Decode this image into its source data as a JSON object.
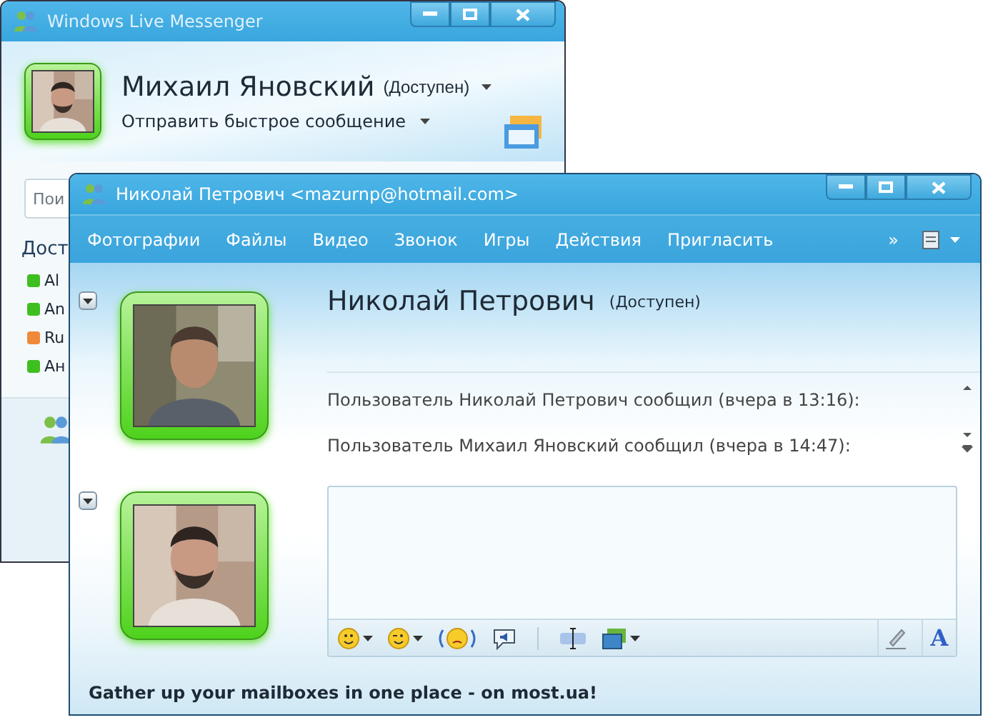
{
  "back_window": {
    "title": "Windows Live Messenger",
    "user_name": "Михаил Яновский",
    "user_status": "(Доступен)",
    "quick_message": "Отправить быстрое сообщение",
    "search": {
      "placeholder": "Пои"
    },
    "group_heading": "Дост",
    "contacts": [
      {
        "name": "Al",
        "color": "#3fbf1f"
      },
      {
        "name": "An",
        "color": "#3fbf1f"
      },
      {
        "name": "Ru",
        "color": "#f08a3a"
      },
      {
        "name": "Ан",
        "color": "#3fbf1f"
      }
    ]
  },
  "chat_window": {
    "title": "Николай Петрович <mazurnp@hotmail.com>",
    "menu": [
      "Фотографии",
      "Файлы",
      "Видео",
      "Звонок",
      "Игры",
      "Действия",
      "Пригласить"
    ],
    "overflow": "»",
    "contact_name": "Николай Петрович",
    "contact_status": "(Доступен)",
    "messages": [
      "Пользователь Николай Петрович сообщил (вчера в 13:16):",
      "Пользователь Михаил Яновский сообщил (вчера в 14:47):"
    ],
    "font_button": "A",
    "footer": "Gather up your mailboxes in one place -  on most.ua!"
  }
}
